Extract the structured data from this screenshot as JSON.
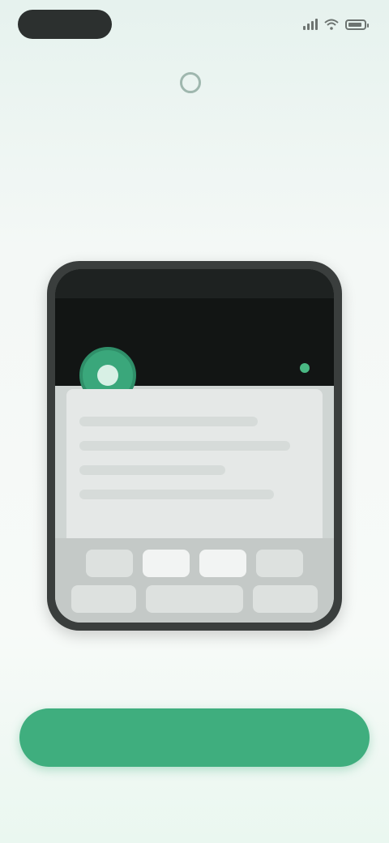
{
  "status_bar": {
    "time": "",
    "icons": [
      "signal-icon",
      "wifi-icon",
      "battery-icon"
    ]
  },
  "brand": {
    "name": "",
    "icon": "brand-logo-icon"
  },
  "headline": "",
  "subhead": "",
  "primary_button": {
    "label": ""
  },
  "footer_links": [
    {
      "label": ""
    },
    {
      "label": ""
    }
  ],
  "colors": {
    "accent": "#3fae7e",
    "subhead": "#a9d8c6",
    "background": "#f4f8f6"
  }
}
